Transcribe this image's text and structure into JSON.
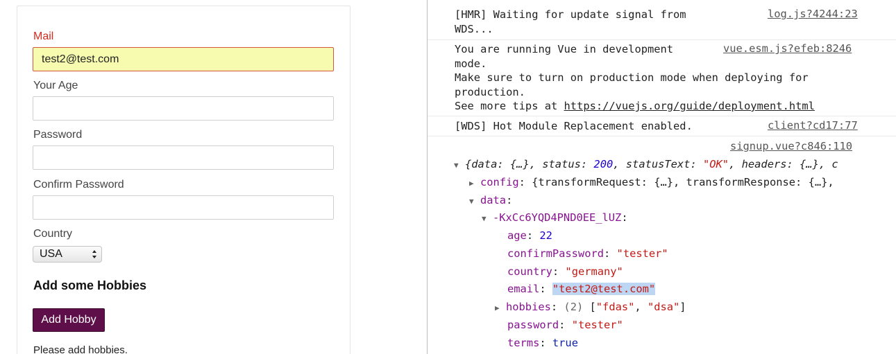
{
  "form": {
    "mail_label": "Mail",
    "mail_value": "test2@test.com",
    "age_label": "Your Age",
    "age_value": "",
    "password_label": "Password",
    "password_value": "",
    "confirm_label": "Confirm Password",
    "confirm_value": "",
    "country_label": "Country",
    "country_selected": "USA",
    "hobbies_heading": "Add some Hobbies",
    "add_hobby_button": "Add Hobby",
    "hobbies_hint": "Please add hobbies."
  },
  "console": {
    "messages": [
      {
        "text": "[HMR] Waiting for update signal from\nWDS...",
        "source": "log.js?4244:23"
      },
      {
        "line1": "You are running Vue in development",
        "line_rest": "mode.\nMake sure to turn on production mode when deploying for\nproduction.",
        "tips_prefix": "See more tips at ",
        "tips_url": "https://vuejs.org/guide/deployment.html",
        "source": "vue.esm.js?efeb:8246"
      },
      {
        "text": "[WDS] Hot Module Replacement enabled.",
        "source": "client?cd17:77"
      }
    ],
    "object_source": "signup.vue?c846:110",
    "summary": {
      "data_key": "data",
      "data_val": "{…}",
      "status_key": "status",
      "status_val": "200",
      "statusText_key": "statusText",
      "statusText_val": "\"OK\"",
      "headers_key": "headers",
      "headers_val": "{…}",
      "tail": ", c"
    },
    "config": {
      "key": "config",
      "value": "{transformRequest: {…}, transformResponse: {…},"
    },
    "data_key": "data",
    "record_key": "-KxCc6YQD4PND0EE_lUZ",
    "fields": {
      "age_key": "age",
      "age_val": "22",
      "confirm_key": "confirmPassword",
      "confirm_val": "\"tester\"",
      "country_key": "country",
      "country_val": "\"germany\"",
      "email_key": "email",
      "email_val": "\"test2@test.com\"",
      "hobbies_key": "hobbies",
      "hobbies_count": "(2)",
      "hobbies_val1": "\"fdas\"",
      "hobbies_val2": "\"dsa\"",
      "password_key": "password",
      "password_val": "\"tester\"",
      "terms_key": "terms",
      "terms_val": "true"
    }
  },
  "colors": {
    "invalid_label": "#d62a1f",
    "invalid_input_bg": "#f6fbb0",
    "button_bg": "#5e0f4a",
    "console_key": "#881391",
    "console_string": "#c41a16",
    "console_number": "#1c00cf"
  }
}
